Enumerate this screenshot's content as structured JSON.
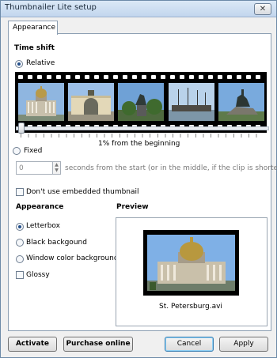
{
  "window": {
    "title": "Thumbnailer Lite setup",
    "close_glyph": "✕"
  },
  "tab": {
    "label": "Appearance"
  },
  "timeshift": {
    "heading": "Time shift",
    "relative_label": "Relative",
    "relative_selected": true,
    "position_text": "1% from the beginning",
    "slider_position_percent": 1,
    "fixed_label": "Fixed",
    "fixed_selected": false,
    "fixed_value": "0",
    "fixed_suffix": "seconds from the start (or in the middle, if the clip is shorter)"
  },
  "embedded": {
    "label": "Don't use embedded thumbnail",
    "checked": false
  },
  "appearance": {
    "heading": "Appearance",
    "options": [
      {
        "label": "Letterbox",
        "selected": true
      },
      {
        "label": "Black backgound",
        "selected": false
      },
      {
        "label": "Window color background",
        "selected": false
      }
    ],
    "glossy_label": "Glossy",
    "glossy_checked": false
  },
  "preview": {
    "heading": "Preview",
    "caption": "St. Petersburg.avi"
  },
  "buttons": {
    "activate": "Activate",
    "purchase": "Purchase online",
    "cancel": "Cancel",
    "apply": "Apply"
  },
  "colors": {
    "title_bar": "#c2d6ee",
    "selection": "#234f8a",
    "default_button_border": "#3c7fb1"
  }
}
